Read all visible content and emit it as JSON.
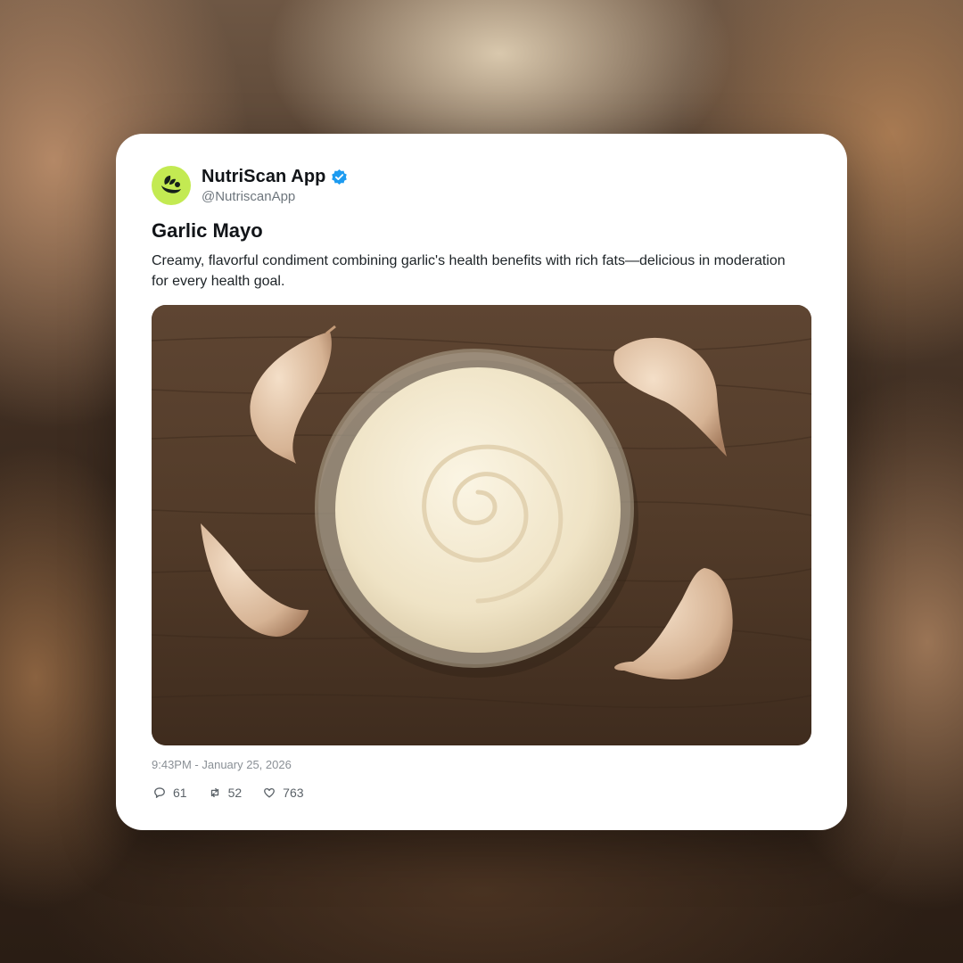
{
  "post": {
    "author": {
      "display_name": "NutriScan App",
      "handle": "@NutriscanApp",
      "verified_icon": "verified-badge-icon",
      "avatar_icon": "nutriscan-logo",
      "avatar_color": "#c3ea52",
      "verified_color": "#1d9bf0"
    },
    "title": "Garlic Mayo",
    "description": "Creamy, flavorful condiment combining garlic's health benefits with rich fats—delicious in moderation for every health goal.",
    "image": {
      "subject": "garlic-mayo-bowl-with-garlic-cloves"
    },
    "timestamp": "9:43PM - January 25, 2026",
    "stats": {
      "replies": "61",
      "reposts": "52",
      "likes": "763"
    }
  }
}
